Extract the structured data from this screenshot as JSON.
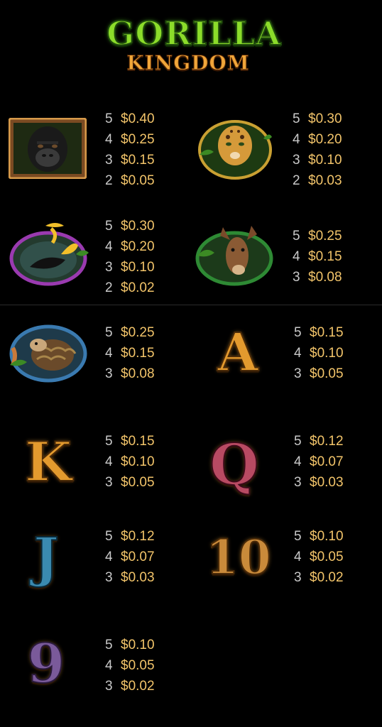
{
  "logo": {
    "line1": "GORILLA",
    "line2": "KINGDOM"
  },
  "symbols": [
    {
      "name": "gorilla",
      "icon": "gorilla-icon",
      "payouts": [
        {
          "count": "5",
          "value": "$0.40"
        },
        {
          "count": "4",
          "value": "$0.25"
        },
        {
          "count": "3",
          "value": "$0.15"
        },
        {
          "count": "2",
          "value": "$0.05"
        }
      ]
    },
    {
      "name": "leopard",
      "icon": "leopard-icon",
      "payouts": [
        {
          "count": "5",
          "value": "$0.30"
        },
        {
          "count": "4",
          "value": "$0.20"
        },
        {
          "count": "3",
          "value": "$0.10"
        },
        {
          "count": "2",
          "value": "$0.03"
        }
      ]
    },
    {
      "name": "hornbill",
      "icon": "hornbill-icon",
      "payouts": [
        {
          "count": "5",
          "value": "$0.30"
        },
        {
          "count": "4",
          "value": "$0.20"
        },
        {
          "count": "3",
          "value": "$0.10"
        },
        {
          "count": "2",
          "value": "$0.02"
        }
      ]
    },
    {
      "name": "okapi",
      "icon": "okapi-icon",
      "payouts": [
        {
          "count": "5",
          "value": "$0.25"
        },
        {
          "count": "4",
          "value": "$0.15"
        },
        {
          "count": "3",
          "value": "$0.08"
        }
      ]
    },
    {
      "name": "pangolin",
      "icon": "pangolin-icon",
      "payouts": [
        {
          "count": "5",
          "value": "$0.25"
        },
        {
          "count": "4",
          "value": "$0.15"
        },
        {
          "count": "3",
          "value": "$0.08"
        }
      ]
    },
    {
      "name": "A",
      "label": "A",
      "payouts": [
        {
          "count": "5",
          "value": "$0.15"
        },
        {
          "count": "4",
          "value": "$0.10"
        },
        {
          "count": "3",
          "value": "$0.05"
        }
      ]
    },
    {
      "name": "K",
      "label": "K",
      "payouts": [
        {
          "count": "5",
          "value": "$0.15"
        },
        {
          "count": "4",
          "value": "$0.10"
        },
        {
          "count": "3",
          "value": "$0.05"
        }
      ]
    },
    {
      "name": "Q",
      "label": "Q",
      "payouts": [
        {
          "count": "5",
          "value": "$0.12"
        },
        {
          "count": "4",
          "value": "$0.07"
        },
        {
          "count": "3",
          "value": "$0.03"
        }
      ]
    },
    {
      "name": "J",
      "label": "J",
      "payouts": [
        {
          "count": "5",
          "value": "$0.12"
        },
        {
          "count": "4",
          "value": "$0.07"
        },
        {
          "count": "3",
          "value": "$0.03"
        }
      ]
    },
    {
      "name": "10",
      "label": "10",
      "payouts": [
        {
          "count": "5",
          "value": "$0.10"
        },
        {
          "count": "4",
          "value": "$0.05"
        },
        {
          "count": "3",
          "value": "$0.02"
        }
      ]
    },
    {
      "name": "9",
      "label": "9",
      "payouts": [
        {
          "count": "5",
          "value": "$0.10"
        },
        {
          "count": "4",
          "value": "$0.05"
        },
        {
          "count": "3",
          "value": "$0.02"
        }
      ]
    }
  ]
}
